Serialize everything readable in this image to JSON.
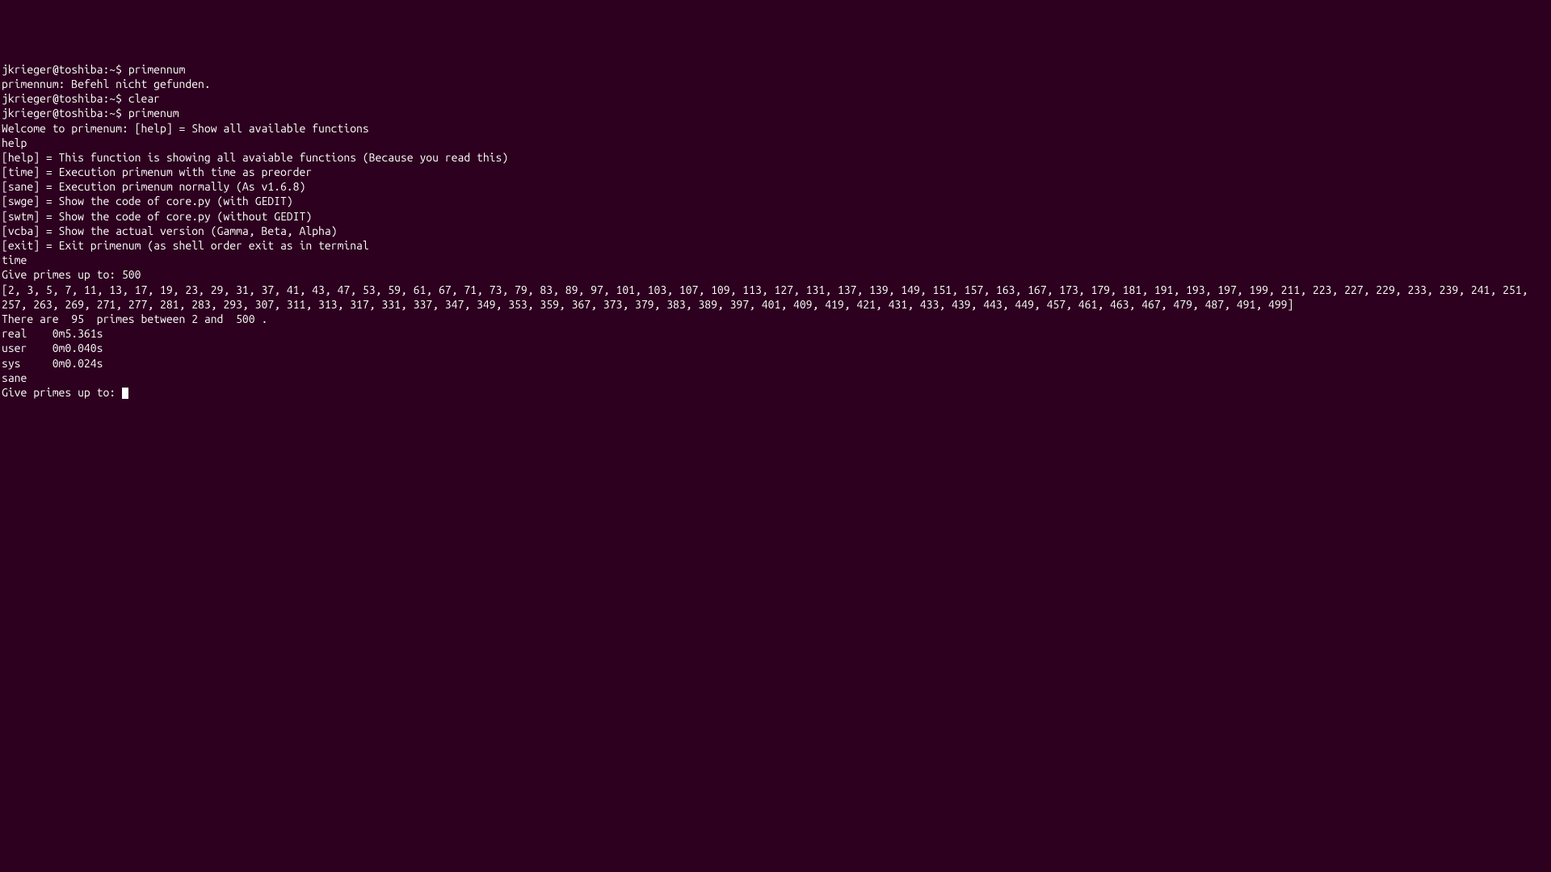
{
  "prompt": "jkrieger@toshiba:~$ ",
  "cmd1": "primennum",
  "err1": "primennum: Befehl nicht gefunden.",
  "cmd2": "clear",
  "blank": "",
  "cmd3": "primenum",
  "welcome": "Welcome to primenum: [help] = Show all available functions",
  "help_cmd": "help",
  "help_lines": {
    "help": "[help] = This function is showing all avaiable functions (Because you read this)",
    "time": "[time] = Execution primenum with time as preorder",
    "sane": "[sane] = Execution primenum normally (As v1.6.8)",
    "swge": "[swge] = Show the code of core.py (with GEDIT)",
    "swtm": "[swtm] = Show the code of core.py (without GEDIT)",
    "vcba": "[vcba] = Show the actual version (Gamma, Beta, Alpha)",
    "exit": "[exit] = Exit primenum (as shell order exit as in terminal"
  },
  "time_cmd": "time",
  "give_primes": "Give primes up to: 500",
  "primes_list": "[2, 3, 5, 7, 11, 13, 17, 19, 23, 29, 31, 37, 41, 43, 47, 53, 59, 61, 67, 71, 73, 79, 83, 89, 97, 101, 103, 107, 109, 113, 127, 131, 137, 139, 149, 151, 157, 163, 167, 173, 179, 181, 191, 193, 197, 199, 211, 223, 227, 229, 233, 239, 241, 251, 257, 263, 269, 271, 277, 281, 283, 293, 307, 311, 313, 317, 331, 337, 347, 349, 353, 359, 367, 373, 379, 383, 389, 397, 401, 409, 419, 421, 431, 433, 439, 443, 449, 457, 461, 463, 467, 479, 487, 491, 499]",
  "count_msg": "There are  95  primes between 2 and  500 .",
  "timing": {
    "real": "real    0m5.361s",
    "user": "user    0m0.040s",
    "sys": "sys     0m0.024s"
  },
  "sane_cmd": "sane",
  "give_primes2": "Give primes up to: "
}
